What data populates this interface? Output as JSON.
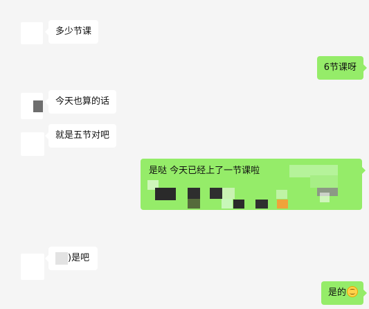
{
  "messages": [
    {
      "side": "left",
      "text": "多少节课"
    },
    {
      "side": "right",
      "text": "6节课呀"
    },
    {
      "side": "left",
      "text": "今天也算的话"
    },
    {
      "side": "left",
      "text": "就是五节对吧"
    },
    {
      "side": "right",
      "text": "是哒 今天已经上了一节课啦"
    },
    {
      "side": "left",
      "text": ")是吧"
    },
    {
      "side": "right",
      "text": "是的",
      "emoji": "smile-emoji"
    }
  ],
  "colors": {
    "background": "#f5f5f5",
    "incoming_bubble": "#ffffff",
    "outgoing_bubble": "#95ec69"
  }
}
